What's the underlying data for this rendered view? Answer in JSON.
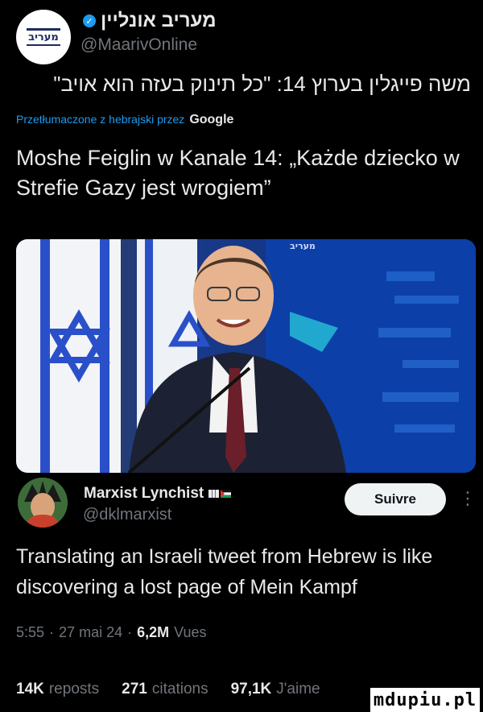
{
  "quoted": {
    "logo_text": "מעריב",
    "name": "מעריב אונליין",
    "handle": "@MaarivOnline",
    "hebrew_text": "משה פייגלין בערוץ 14: \"כל תינוק בעזה הוא אויב\"",
    "translated_by": "Przetłumaczone z hebrajski przez",
    "translator": "Google",
    "translation": "Moshe Feiglin w Kanale 14: „Każde dziecko w Strefie Gazy jest wrogiem”"
  },
  "photo": {
    "banner_text": "מעריב"
  },
  "author": {
    "name": "Marxist Lynchist",
    "handle": "@dklmarxist",
    "follow_label": "Suivre",
    "more_label": "⋮"
  },
  "tweet": {
    "text": "Translating an Israeli tweet from Hebrew is like discovering a lost page of Mein Kampf"
  },
  "meta": {
    "time": "5:55",
    "sep1": "·",
    "date": "27 mai 24",
    "sep2": "·",
    "views_count": "6,2M",
    "views_label": "Vues"
  },
  "stats": {
    "reposts_count": "14K",
    "reposts_label": "reposts",
    "quotes_count": "271",
    "quotes_label": "citations",
    "likes_count": "97,1K",
    "likes_label": "J'aime"
  },
  "watermark": "mdupiu.pl",
  "colors": {
    "background": "#000000",
    "text": "#e7e9ea",
    "muted": "#71767b",
    "link": "#1d9bf0",
    "follow_bg": "#eff3f4"
  },
  "icons": [
    "verified-badge-icon",
    "more-options-icon",
    "palestine-flag-icon",
    "flag-icon"
  ]
}
